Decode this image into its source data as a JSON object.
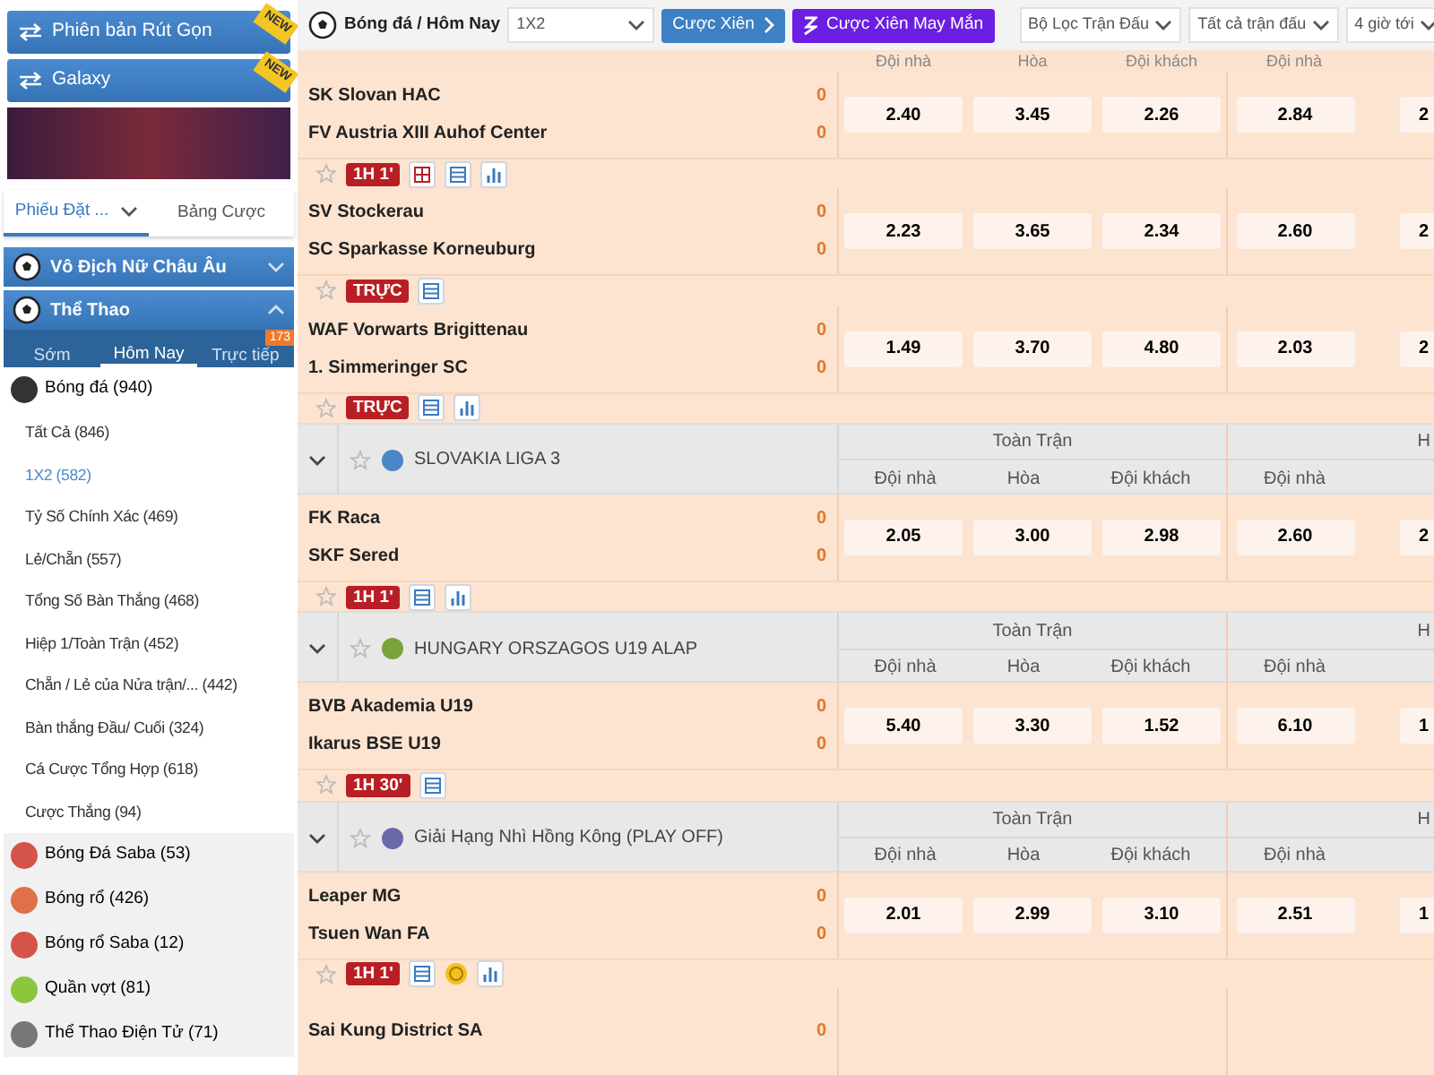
{
  "sidebar": {
    "promo_buttons": [
      {
        "label": "Phiên bản Rút Gọn",
        "badge": "NEW"
      },
      {
        "label": "Galaxy",
        "badge": "NEW"
      }
    ],
    "bet_tabs": [
      {
        "label": "Phiếu Đặt ...",
        "selected": true
      },
      {
        "label": "Bảng Cược",
        "selected": false
      }
    ],
    "sections": [
      {
        "title": "Vô Địch Nữ Châu Âu",
        "expanded": false
      },
      {
        "title": "Thể Thao",
        "expanded": true
      }
    ],
    "time_tabs": [
      {
        "label": "Sớm",
        "selected": false
      },
      {
        "label": "Hôm Nay",
        "selected": true
      },
      {
        "label": "Trực tiếp",
        "selected": false,
        "badge": "173"
      }
    ],
    "sports": [
      {
        "name": "Bóng đá",
        "count": "(940)",
        "color": "#333333",
        "children": [
          {
            "name": "Tất Cả",
            "count": "(846)",
            "selected": false
          },
          {
            "name": "1X2",
            "count": "(582)",
            "selected": true
          },
          {
            "name": "Tỷ Số Chính Xác",
            "count": "(469)",
            "selected": false
          },
          {
            "name": "Lẻ/Chẵn",
            "count": "(557)",
            "selected": false
          },
          {
            "name": "Tổng Số Bàn Thắng",
            "count": "(468)",
            "selected": false
          },
          {
            "name": "Hiệp 1/Toàn Trận",
            "count": "(452)",
            "selected": false
          },
          {
            "name": "Chẵn / Lẻ của Nửa trận/...",
            "count": "(442)",
            "selected": false
          },
          {
            "name": "Bàn thắng Đầu/ Cuối",
            "count": "(324)",
            "selected": false
          },
          {
            "name": "Cá Cược Tổng Hợp",
            "count": "(618)",
            "selected": false
          },
          {
            "name": "Cược Thắng",
            "count": "(94)",
            "selected": false
          }
        ]
      },
      {
        "name": "Bóng Đá Saba",
        "count": "(53)",
        "color": "#d4544a"
      },
      {
        "name": "Bóng rổ",
        "count": "(426)",
        "color": "#e0704a"
      },
      {
        "name": "Bóng rổ Saba",
        "count": "(12)",
        "color": "#d4544a"
      },
      {
        "name": "Quần vợt",
        "count": "(81)",
        "color": "#8cc63f"
      },
      {
        "name": "Thể Thao Điện Tử",
        "count": "(71)",
        "color": "#777777"
      }
    ]
  },
  "toolbar": {
    "breadcrumb": "Bóng đá / Hôm Nay",
    "market_select": "1X2",
    "buttons": [
      {
        "label": "Cược Xiên",
        "kind": "parlay"
      },
      {
        "label": "Cược Xiên May Mắn",
        "kind": "lucky"
      }
    ],
    "filters": [
      "Bộ Lọc Trận Đấu",
      "Tất cả trận đấu",
      "4 giờ tới"
    ]
  },
  "events": [
    {
      "kind": "columns",
      "labels": [
        "Đội nhà",
        "Hòa",
        "Đội khách",
        "Đội nhà"
      ]
    },
    {
      "kind": "match",
      "home": "SK Slovan HAC",
      "away": "FV Austria XIII Auhof Center",
      "home_score": "0",
      "away_score": "0",
      "odds": [
        "2.40",
        "3.45",
        "2.26",
        "2.84",
        "2"
      ],
      "status": "1H 1'",
      "tools": [
        {
          "kind": "grid"
        },
        {
          "kind": "list"
        },
        {
          "kind": "stats"
        }
      ]
    },
    {
      "kind": "match",
      "home": "SV Stockerau",
      "away": "SC Sparkasse Korneuburg",
      "home_score": "0",
      "away_score": "0",
      "odds": [
        "2.23",
        "3.65",
        "2.34",
        "2.60",
        "2"
      ],
      "status": "TRỰC",
      "tools": [
        {
          "kind": "list"
        }
      ]
    },
    {
      "kind": "match",
      "home": "WAF Vorwarts Brigittenau",
      "away": "1. Simmeringer SC",
      "home_score": "0",
      "away_score": "0",
      "odds": [
        "1.49",
        "3.70",
        "4.80",
        "2.03",
        "2"
      ],
      "status": "TRỰC",
      "tools": [
        {
          "kind": "list"
        },
        {
          "kind": "stats"
        }
      ]
    },
    {
      "kind": "league",
      "name": "SLOVAKIA LIGA 3",
      "color": "#4a86c5",
      "groups": [
        "Toàn Trận",
        "H"
      ],
      "labels": [
        "Đội nhà",
        "Hòa",
        "Đội khách",
        "Đội nhà"
      ]
    },
    {
      "kind": "match",
      "home": "FK Raca",
      "away": "SKF Sered",
      "home_score": "0",
      "away_score": "0",
      "odds": [
        "2.05",
        "3.00",
        "2.98",
        "2.60",
        "2"
      ],
      "status": "1H 1'",
      "tools": [
        {
          "kind": "list"
        },
        {
          "kind": "stats"
        }
      ]
    },
    {
      "kind": "league",
      "name": "HUNGARY ORSZAGOS U19 ALAP",
      "color": "#7aa33a",
      "groups": [
        "Toàn Trận",
        "H"
      ],
      "labels": [
        "Đội nhà",
        "Hòa",
        "Đội khách",
        "Đội nhà"
      ]
    },
    {
      "kind": "match",
      "home": "BVB Akademia U19",
      "away": "Ikarus BSE U19",
      "home_score": "0",
      "away_score": "0",
      "odds": [
        "5.40",
        "3.30",
        "1.52",
        "6.10",
        "1"
      ],
      "status": "1H 30'",
      "tools": [
        {
          "kind": "list"
        }
      ]
    },
    {
      "kind": "league",
      "name": "Giải Hạng Nhì Hồng Kông (PLAY OFF)",
      "color": "#6a6aa8",
      "groups": [
        "Toàn Trận",
        "H"
      ],
      "labels": [
        "Đội nhà",
        "Hòa",
        "Đội khách",
        "Đội nhà"
      ]
    },
    {
      "kind": "match",
      "home": "Leaper MG",
      "away": "Tsuen Wan FA",
      "home_score": "0",
      "away_score": "0",
      "odds": [
        "2.01",
        "2.99",
        "3.10",
        "2.51",
        "1"
      ],
      "status": "1H 1'",
      "tools": [
        {
          "kind": "list"
        },
        {
          "kind": "coin"
        },
        {
          "kind": "stats"
        }
      ]
    },
    {
      "kind": "match",
      "home": "Sai Kung District SA",
      "home_score": "0"
    }
  ]
}
